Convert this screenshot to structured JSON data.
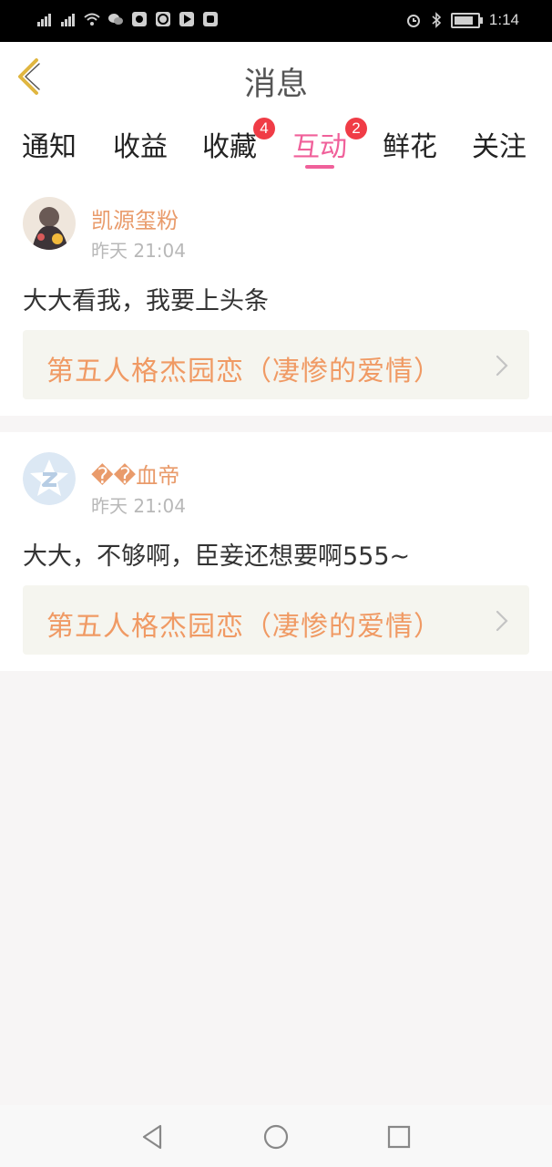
{
  "status_bar": {
    "time": "1:14",
    "battery_level": 0.85
  },
  "header": {
    "title": "消息",
    "back_icon": "chevron-left-icon"
  },
  "tabs": [
    {
      "label": "通知",
      "badge": null,
      "active": false
    },
    {
      "label": "收益",
      "badge": null,
      "active": false
    },
    {
      "label": "收藏",
      "badge": "4",
      "active": false
    },
    {
      "label": "互动",
      "badge": "2",
      "active": true
    },
    {
      "label": "鲜花",
      "badge": null,
      "active": false
    },
    {
      "label": "关注",
      "badge": null,
      "active": false
    }
  ],
  "messages": [
    {
      "username": "凯源玺粉",
      "time": "昨天 21:04",
      "content": "大大看我，我要上头条",
      "link_title": "第五人格杰园恋（凄惨的爱情）"
    },
    {
      "username": "��血帝",
      "time": "昨天 21:04",
      "content": "大大，不够啊，臣妾还想要啊555~",
      "link_title": "第五人格杰园恋（凄惨的爱情）"
    }
  ],
  "colors": {
    "accent": "#f0609a",
    "badge": "#f03c46",
    "username": "#e99b6b",
    "link": "#f09a64"
  }
}
